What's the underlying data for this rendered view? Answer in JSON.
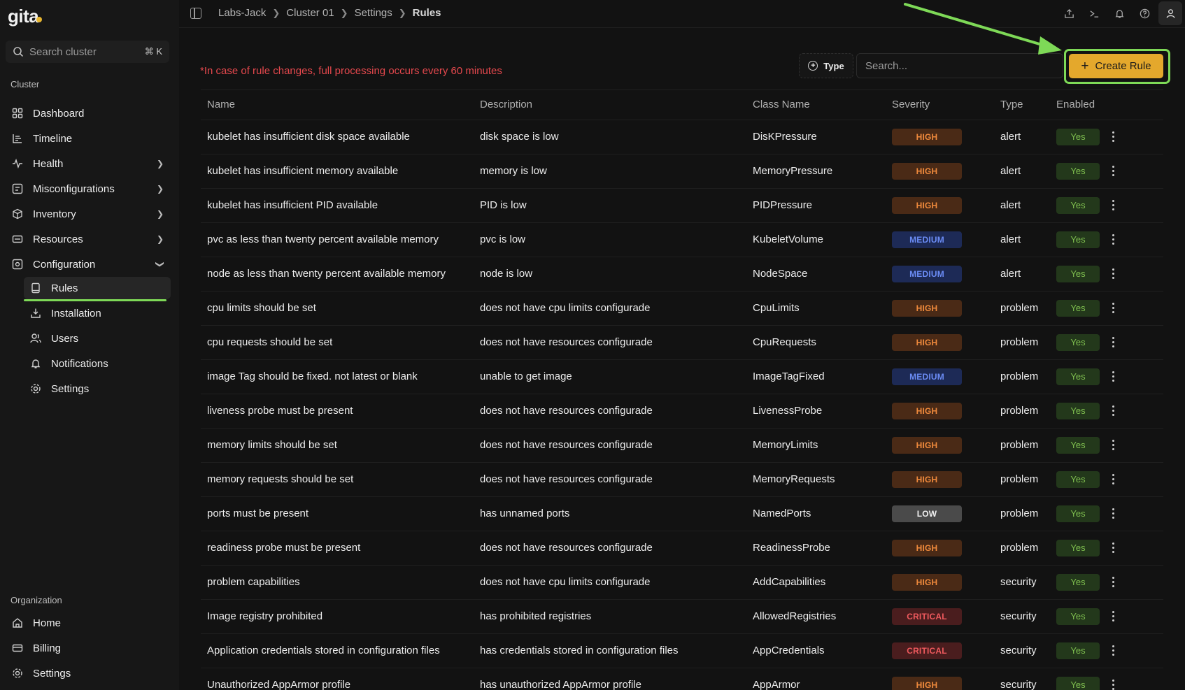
{
  "sidebar": {
    "logo": "gita",
    "search": {
      "placeholder": "Search cluster",
      "shortcut": "⌘ K"
    },
    "cluster_label": "Cluster",
    "items": [
      {
        "label": "Dashboard",
        "icon": "grid-icon"
      },
      {
        "label": "Timeline",
        "icon": "timeline-icon"
      },
      {
        "label": "Health",
        "icon": "pulse-icon"
      },
      {
        "label": "Misconfigurations",
        "icon": "misconfig-icon"
      },
      {
        "label": "Inventory",
        "icon": "box-icon"
      },
      {
        "label": "Resources",
        "icon": "resources-icon"
      },
      {
        "label": "Configuration",
        "icon": "config-icon"
      }
    ],
    "config_items": [
      {
        "label": "Rules",
        "icon": "book-icon"
      },
      {
        "label": "Installation",
        "icon": "install-icon"
      },
      {
        "label": "Users",
        "icon": "users-icon"
      },
      {
        "label": "Notifications",
        "icon": "bell-icon"
      },
      {
        "label": "Settings",
        "icon": "gear-icon"
      }
    ],
    "org_label": "Organization",
    "org_items": [
      {
        "label": "Home",
        "icon": "home-icon"
      },
      {
        "label": "Billing",
        "icon": "card-icon"
      },
      {
        "label": "Settings",
        "icon": "gear-icon"
      }
    ]
  },
  "breadcrumb": [
    "Labs-Jack",
    "Cluster 01",
    "Settings",
    "Rules"
  ],
  "notice": "*In case of rule changes, full processing occurs every 60 minutes",
  "toolbar": {
    "type_filter": "Type",
    "search_placeholder": "Search...",
    "create_label": "Create Rule"
  },
  "table": {
    "headers": [
      "Name",
      "Description",
      "Class Name",
      "Severity",
      "Type",
      "Enabled"
    ],
    "rows": [
      [
        "kubelet has insufficient disk space available",
        "disk space is low",
        "DisKPressure",
        "HIGH",
        "alert",
        "Yes"
      ],
      [
        "kubelet has insufficient memory available",
        "memory is low",
        "MemoryPressure",
        "HIGH",
        "alert",
        "Yes"
      ],
      [
        "kubelet has insufficient PID available",
        "PID is low",
        "PIDPressure",
        "HIGH",
        "alert",
        "Yes"
      ],
      [
        "pvc as less than twenty percent available memory",
        "pvc is low",
        "KubeletVolume",
        "MEDIUM",
        "alert",
        "Yes"
      ],
      [
        "node as less than twenty percent available memory",
        "node is low",
        "NodeSpace",
        "MEDIUM",
        "alert",
        "Yes"
      ],
      [
        "cpu limits should be set",
        "does not have cpu limits configurade",
        "CpuLimits",
        "HIGH",
        "problem",
        "Yes"
      ],
      [
        "cpu requests should be set",
        "does not have resources configurade",
        "CpuRequests",
        "HIGH",
        "problem",
        "Yes"
      ],
      [
        "image Tag should be fixed. not latest or blank",
        "unable to get image",
        "ImageTagFixed",
        "MEDIUM",
        "problem",
        "Yes"
      ],
      [
        "liveness probe must be present",
        "does not have resources configurade",
        "LivenessProbe",
        "HIGH",
        "problem",
        "Yes"
      ],
      [
        "memory limits should be set",
        "does not have resources configurade",
        "MemoryLimits",
        "HIGH",
        "problem",
        "Yes"
      ],
      [
        "memory requests should be set",
        "does not have resources configurade",
        "MemoryRequests",
        "HIGH",
        "problem",
        "Yes"
      ],
      [
        "ports must be present",
        "has unnamed ports",
        "NamedPorts",
        "LOW",
        "problem",
        "Yes"
      ],
      [
        "readiness probe must be present",
        "does not have resources configurade",
        "ReadinessProbe",
        "HIGH",
        "problem",
        "Yes"
      ],
      [
        "problem capabilities",
        "does not have cpu limits configurade",
        "AddCapabilities",
        "HIGH",
        "security",
        "Yes"
      ],
      [
        "Image registry prohibited",
        "has prohibited registries",
        "AllowedRegistries",
        "CRITICAL",
        "security",
        "Yes"
      ],
      [
        "Application credentials stored in configuration files",
        "has credentials stored in configuration files",
        "AppCredentials",
        "CRITICAL",
        "security",
        "Yes"
      ],
      [
        "Unauthorized AppArmor profile",
        "has unauthorized AppArmor profile",
        "AppArmor",
        "HIGH",
        "security",
        "Yes"
      ]
    ]
  },
  "colors": {
    "accent": "#e4a82c",
    "highlight": "#7ed957",
    "notice": "#e5484d"
  }
}
